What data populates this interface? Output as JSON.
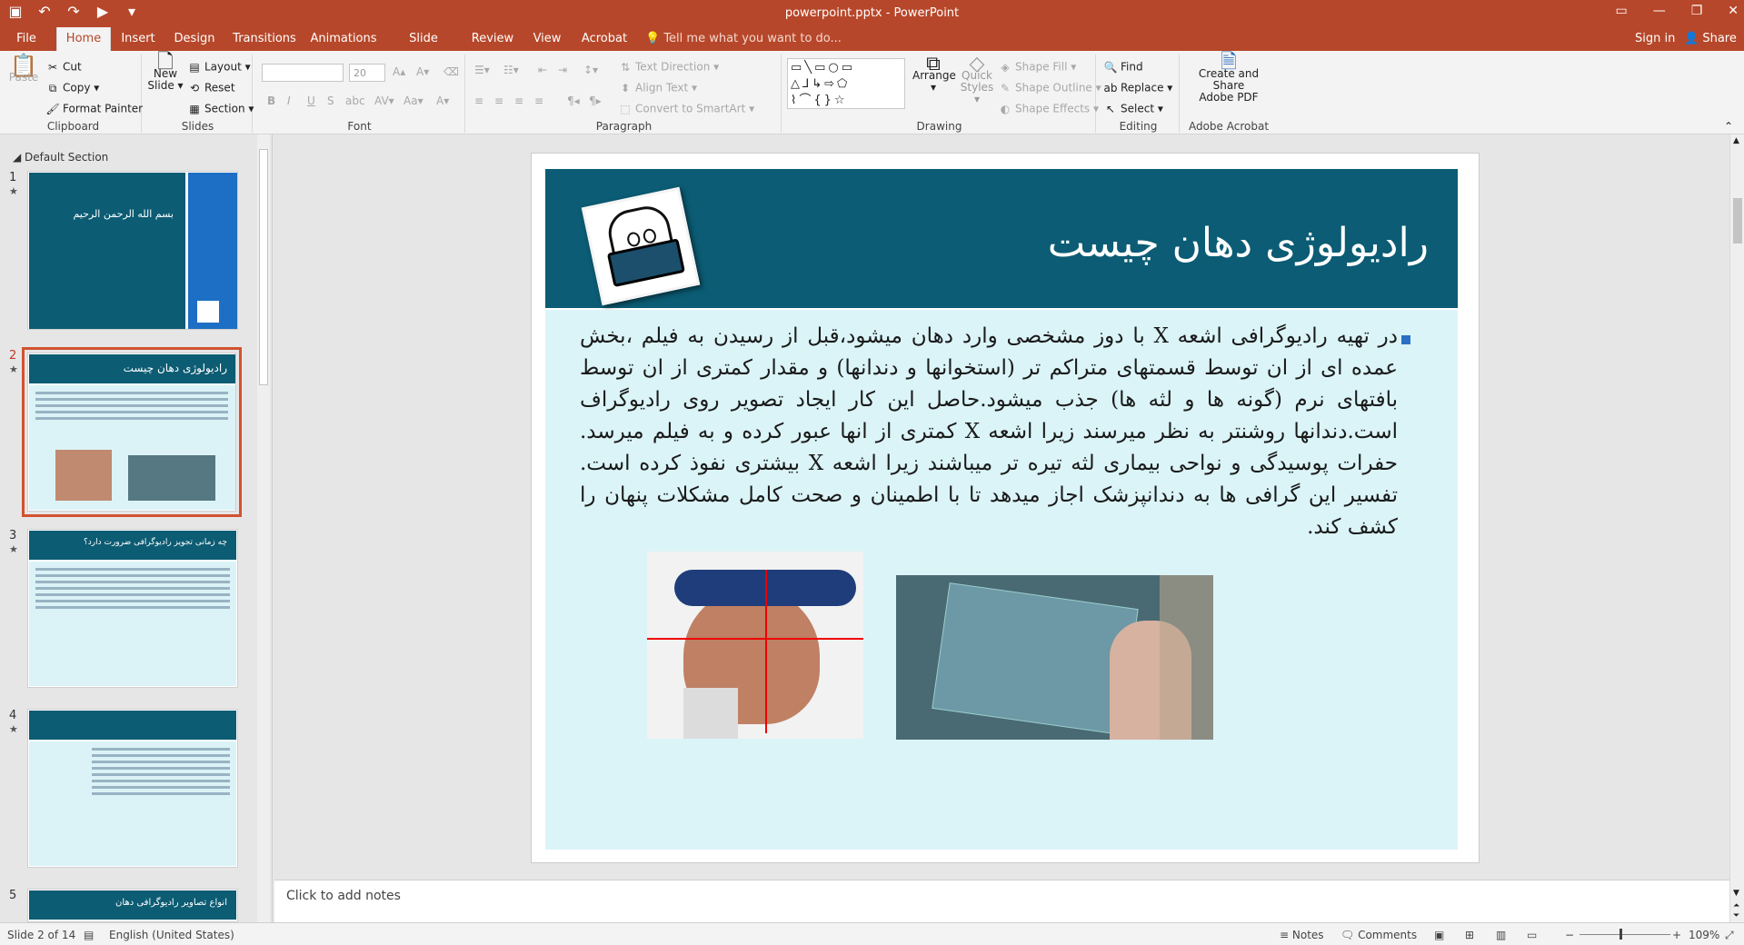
{
  "window": {
    "title": "powerpoint.pptx - PowerPoint",
    "controls": [
      "minimize-icon",
      "maximize-icon",
      "close-icon"
    ]
  },
  "tabs": {
    "file": "File",
    "home": "Home",
    "insert": "Insert",
    "design": "Design",
    "transitions": "Transitions",
    "animations": "Animations",
    "slideshow": "Slide Show",
    "review": "Review",
    "view": "View",
    "acrobat": "Acrobat",
    "tell": "Tell me what you want to do...",
    "signin": "Sign in",
    "share": "Share"
  },
  "ribbon": {
    "clipboard": {
      "label": "Clipboard",
      "paste": "Paste",
      "cut": "Cut",
      "copy": "Copy",
      "painter": "Format Painter"
    },
    "slides": {
      "label": "Slides",
      "new1": "New",
      "new2": "Slide",
      "layout": "Layout",
      "reset": "Reset",
      "section": "Section"
    },
    "font": {
      "label": "Font",
      "size": "20"
    },
    "paragraph": {
      "label": "Paragraph",
      "direction": "Text Direction",
      "align": "Align Text",
      "smartart": "Convert to SmartArt"
    },
    "drawing": {
      "label": "Drawing",
      "arrange": "Arrange",
      "quick1": "Quick",
      "quick2": "Styles",
      "fill": "Shape Fill",
      "outline": "Shape Outline",
      "effects": "Shape Effects"
    },
    "editing": {
      "label": "Editing",
      "find": "Find",
      "replace": "Replace",
      "select": "Select"
    },
    "acrobat": {
      "label": "Adobe Acrobat",
      "create1": "Create and Share",
      "create2": "Adobe PDF"
    }
  },
  "panel": {
    "section": "Default Section",
    "slides": [
      {
        "num": "1",
        "title": "بسم الله الرحمن الرحيم"
      },
      {
        "num": "2",
        "title": "رادیولوژی دهان چیست"
      },
      {
        "num": "3",
        "title": "چه زمانی تجویز رادیوگرافی ضرورت دارد؟"
      },
      {
        "num": "4",
        "title": ""
      },
      {
        "num": "5",
        "title": "انواع تصاویر رادیوگرافی دهان"
      }
    ]
  },
  "slide": {
    "title": "رادیولوژی دهان چیست",
    "body": "در تهیه رادیوگرافی اشعه X با دوز مشخصی وارد دهان میشود،قبل از رسیدن به فیلم ،بخش عمده ای از ان توسط قسمتهای متراکم تر (استخوانها و دندانها) و مقدار کمتری از ان توسط بافتهای نرم (گونه ها و لثه ها) جذب میشود.حاصل این کار ایجاد تصویر روی رادیوگراف است.دندانها روشنتر به نظر میرسند زیرا اشعه X کمتری از انها عبور کرده و به فیلم میرسد. حفرات پوسیدگی و نواحی بیماری لثه تیره تر میباشند زیرا اشعه X بیشتری نفوذ کرده است. تفسیر این گرافی ها به دندانپزشک اجاز میدهد تا با اطمینان و صحت کامل مشکلات پنهان را کشف کند."
  },
  "notes": "Click to add notes",
  "status": {
    "slide": "Slide 2 of 14",
    "language": "English (United States)",
    "notes": "Notes",
    "comments": "Comments",
    "zoom": "109%"
  }
}
